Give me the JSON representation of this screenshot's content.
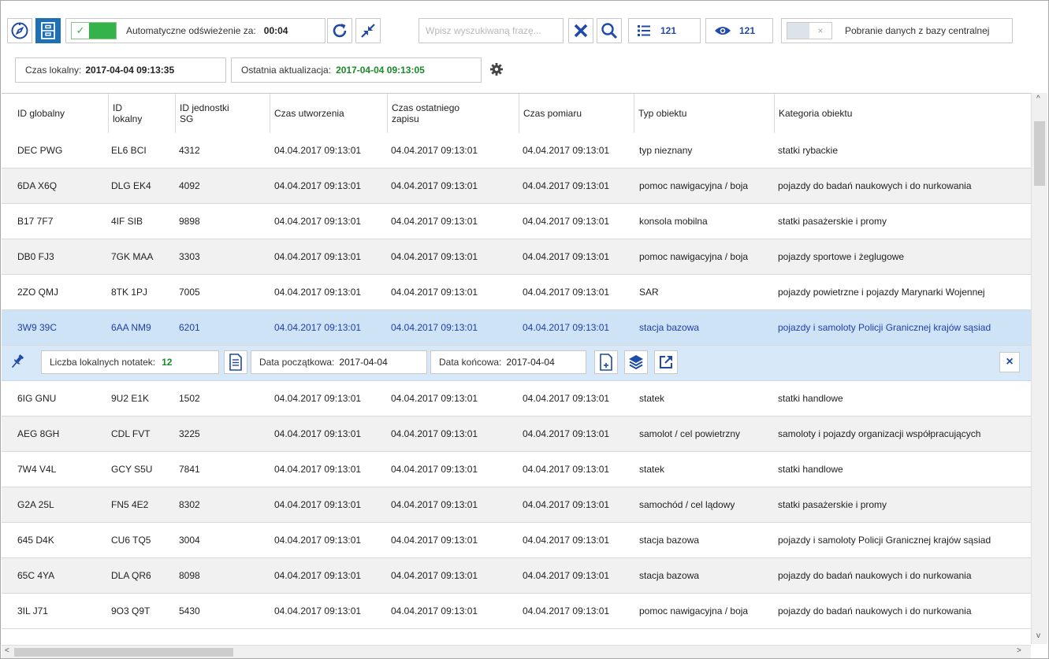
{
  "toolbar": {
    "auto_refresh_label": "Automatyczne odświeżenie za:",
    "auto_refresh_countdown": "00:04",
    "search_placeholder": "Wpisz wyszukiwaną frazę...",
    "list_count": "121",
    "visible_count": "121",
    "central_db_label": "Pobranie danych z bazy centralnej",
    "central_db_toggle": "×",
    "auto_refresh_enabled": true
  },
  "status": {
    "local_time_label": "Czas lokalny:",
    "local_time_value": "2017-04-04 09:13:35",
    "last_update_label": "Ostatnia aktualizacja:",
    "last_update_value": "2017-04-04 09:13:05"
  },
  "table": {
    "columns": [
      "ID globalny",
      "ID\nlokalny",
      "ID jednostki\nSG",
      "Czas utworzenia",
      "Czas ostatniego\nzapisu",
      "Czas pomiaru",
      "Typ obiektu",
      "Kategoria obiektu"
    ],
    "rows_before": [
      [
        "DEC PWG",
        "EL6 BCI",
        "4312",
        "04.04.2017 09:13:01",
        "04.04.2017 09:13:01",
        "04.04.2017 09:13:01",
        "typ nieznany",
        "statki rybackie"
      ],
      [
        "6DA X6Q",
        "DLG EK4",
        "4092",
        "04.04.2017 09:13:01",
        "04.04.2017 09:13:01",
        "04.04.2017 09:13:01",
        "pomoc nawigacyjna / boja",
        "pojazdy do badań naukowych i do nurkowania"
      ],
      [
        "B17 7F7",
        "4IF SIB",
        "9898",
        "04.04.2017 09:13:01",
        "04.04.2017 09:13:01",
        "04.04.2017 09:13:01",
        "konsola mobilna",
        "statki pasażerskie i promy"
      ],
      [
        "DB0 FJ3",
        "7GK MAA",
        "3303",
        "04.04.2017 09:13:01",
        "04.04.2017 09:13:01",
        "04.04.2017 09:13:01",
        "pomoc nawigacyjna / boja",
        "pojazdy sportowe i żeglugowe"
      ],
      [
        "2ZO QMJ",
        "8TK 1PJ",
        "7005",
        "04.04.2017 09:13:01",
        "04.04.2017 09:13:01",
        "04.04.2017 09:13:01",
        "SAR",
        "pojazdy powietrzne i pojazdy Marynarki Wojennej"
      ]
    ],
    "selected_row": [
      "3W9 39C",
      "6AA NM9",
      "6201",
      "04.04.2017 09:13:01",
      "04.04.2017 09:13:01",
      "04.04.2017 09:13:01",
      "stacja bazowa",
      "pojazdy i samoloty Policji Granicznej krajów sąsiad"
    ],
    "rows_after": [
      [
        "6IG GNU",
        "9U2 E1K",
        "1502",
        "04.04.2017 09:13:01",
        "04.04.2017 09:13:01",
        "04.04.2017 09:13:01",
        "statek",
        "statki handlowe"
      ],
      [
        "AEG 8GH",
        "CDL FVT",
        "3225",
        "04.04.2017 09:13:01",
        "04.04.2017 09:13:01",
        "04.04.2017 09:13:01",
        "samolot / cel powietrzny",
        "samoloty i pojazdy organizacji współpracujących"
      ],
      [
        "7W4 V4L",
        "GCY S5U",
        "7841",
        "04.04.2017 09:13:01",
        "04.04.2017 09:13:01",
        "04.04.2017 09:13:01",
        "statek",
        "statki handlowe"
      ],
      [
        "G2A 25L",
        "FN5 4E2",
        "8302",
        "04.04.2017 09:13:01",
        "04.04.2017 09:13:01",
        "04.04.2017 09:13:01",
        "samochód / cel lądowy",
        "statki pasażerskie i promy"
      ],
      [
        "645 D4K",
        "CU6 TQ5",
        "3004",
        "04.04.2017 09:13:01",
        "04.04.2017 09:13:01",
        "04.04.2017 09:13:01",
        "stacja bazowa",
        "pojazdy i samoloty Policji Granicznej krajów sąsiad"
      ],
      [
        "65C 4YA",
        "DLA QR6",
        "8098",
        "04.04.2017 09:13:01",
        "04.04.2017 09:13:01",
        "04.04.2017 09:13:01",
        "stacja bazowa",
        "pojazdy do badań naukowych i do nurkowania"
      ],
      [
        "3IL J71",
        "9O3 Q9T",
        "5430",
        "04.04.2017 09:13:01",
        "04.04.2017 09:13:01",
        "04.04.2017 09:13:01",
        "pomoc nawigacyjna / boja",
        "pojazdy do badań naukowych i do nurkowania"
      ]
    ]
  },
  "detail": {
    "notes_label": "Liczba lokalnych notatek:",
    "notes_count": "12",
    "start_date_label": "Data początkowa:",
    "start_date_value": "2017-04-04",
    "end_date_label": "Data końcowa:",
    "end_date_value": "2017-04-04",
    "close_label": "×"
  },
  "icons": [
    "compass-icon",
    "cabinet-icon",
    "refresh-icon",
    "collapse-icon",
    "clear-icon",
    "search-icon",
    "list-icon",
    "eye-icon",
    "gear-icon",
    "pin-icon",
    "document-icon",
    "add-document-icon",
    "layers-icon",
    "external-link-icon",
    "close-icon"
  ],
  "colors": {
    "accent_blue": "#1f6fb5",
    "toggle_green": "#34b34a",
    "selected_row_bg": "#cfe3f7",
    "selected_row_text": "#1f3fa8",
    "timestamp_green": "#1a8a2a"
  }
}
